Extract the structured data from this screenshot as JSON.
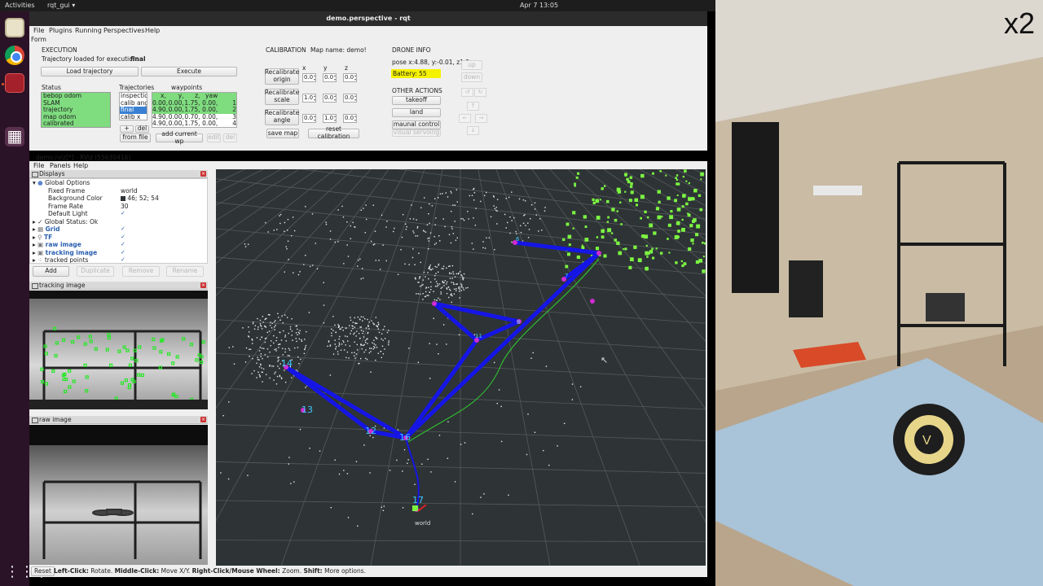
{
  "system": {
    "activities": "Activities",
    "app_menu": "rqt_gui ▾",
    "clock": "Apr 7  13:05"
  },
  "window": {
    "title": "demo.perspective - rqt",
    "menus": [
      "File",
      "Plugins",
      "Running",
      "Perspectives",
      "Help"
    ],
    "form_title": "Form"
  },
  "execution": {
    "header": "EXECUTION",
    "loaded_prefix": "Trajectory loaded for execution:",
    "loaded_name": "final",
    "load_button": "Load trajectory",
    "execute_button": "Execute"
  },
  "status": {
    "header": "Status",
    "items": [
      "bebop odom",
      "SLAM",
      "trajectory",
      "map odom",
      "calibrated"
    ]
  },
  "trajectories": {
    "header": "Trajectories",
    "items": [
      "inspectio",
      "calib ang",
      "final",
      "calib x"
    ],
    "selected_index": 2,
    "plus": "+",
    "del": "del",
    "from_file": "from file"
  },
  "waypoints": {
    "header": "waypoints",
    "columns": [
      "x,",
      "y,",
      "z,",
      "yaw",
      ""
    ],
    "rows": [
      [
        "0.00,",
        "0.00,",
        "1.75,",
        "0.00,",
        "1"
      ],
      [
        "4.90,",
        "0.00,",
        "1.75,",
        "0.00,",
        "2"
      ],
      [
        "4.90,",
        "0.00,",
        "0.70,",
        "0.00,",
        "3"
      ],
      [
        "4.90,",
        "0.00,",
        "1.75,",
        "0.00,",
        "4"
      ]
    ],
    "add_current": "add current wp",
    "edit": "edit",
    "del": "del"
  },
  "calibration": {
    "header": "CALIBRATION",
    "map_name": "Map name: demo!",
    "axes": [
      "x",
      "y",
      "z"
    ],
    "rows": [
      {
        "label": "Recalibrate origin",
        "values": [
          "0.0",
          "0.0",
          "0.0"
        ]
      },
      {
        "label": "Recalibrate scale",
        "values": [
          "1.0",
          "0.0",
          "0.0"
        ]
      },
      {
        "label": "Recalibrate angle",
        "values": [
          "0.0",
          "1.0",
          "0.0"
        ]
      }
    ],
    "save_map": "save map",
    "reset_calibration": "reset calibration"
  },
  "drone": {
    "header": "DRONE INFO",
    "pose": "pose x:4.88, y:-0.01, z1.2",
    "battery": "Battery: 55",
    "other_header": "OTHER ACTIONS",
    "takeoff": "takeoff",
    "land": "land",
    "manual": "maunal control",
    "visual": "visual servoing",
    "up": "up",
    "down": "down"
  },
  "rviz": {
    "title": "demo.rviz[*] - RViz (55630416)",
    "menus": [
      "File",
      "Panels",
      "Help"
    ],
    "displays_title": "Displays",
    "tree": [
      {
        "key": "Global Options",
        "value": "",
        "indent": 1,
        "style": "normal"
      },
      {
        "key": "Fixed Frame",
        "value": "world",
        "indent": 2,
        "style": "normal"
      },
      {
        "key": "Background Color",
        "value": "46; 52; 54",
        "indent": 2,
        "style": "normal"
      },
      {
        "key": "Frame Rate",
        "value": "30",
        "indent": 2,
        "style": "normal"
      },
      {
        "key": "Default Light",
        "value": "✓",
        "indent": 2,
        "style": "normal"
      },
      {
        "key": "Global Status: Ok",
        "value": "",
        "indent": 1,
        "style": "normal"
      },
      {
        "key": "Grid",
        "value": "✓",
        "indent": 1,
        "style": "blue"
      },
      {
        "key": "TF",
        "value": "✓",
        "indent": 1,
        "style": "blue"
      },
      {
        "key": "raw image",
        "value": "✓",
        "indent": 1,
        "style": "blue"
      },
      {
        "key": "tracking image",
        "value": "✓",
        "indent": 1,
        "style": "blue"
      },
      {
        "key": "tracked points",
        "value": "✓",
        "indent": 1,
        "style": "normal"
      }
    ],
    "add": "Add",
    "duplicate": "Duplicate",
    "remove": "Remove",
    "rename": "Rename",
    "tracking_image": "tracking image",
    "raw_image": "raw image",
    "frame_labels": [
      "6",
      "7",
      "8",
      "11",
      "12",
      "13",
      "14",
      "16",
      "17",
      "world"
    ]
  },
  "statusbar": {
    "reset": "Reset",
    "left_click": "Left-Click:",
    "left_text": "Rotate.",
    "middle_click": "Middle-Click:",
    "middle_text": "Move X/Y.",
    "right_click": "Right-Click/Mouse Wheel:",
    "right_text": "Zoom.",
    "shift": "Shift:",
    "shift_text": "More options."
  },
  "overlay": {
    "speed": "x2"
  }
}
